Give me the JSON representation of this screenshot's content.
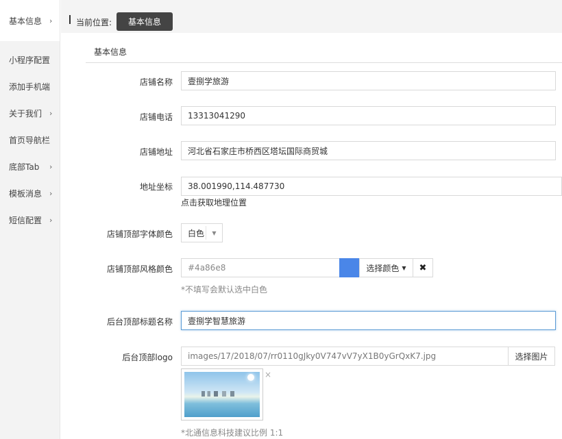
{
  "sidebar": {
    "items": [
      {
        "label": "基本信息",
        "chevron": "›"
      },
      {
        "label": "小程序配置",
        "chevron": ""
      },
      {
        "label": "添加手机端",
        "chevron": ""
      },
      {
        "label": "关于我们",
        "chevron": "›"
      },
      {
        "label": "首页导航栏",
        "chevron": ""
      },
      {
        "label": "底部Tab",
        "chevron": "›"
      },
      {
        "label": "模板消息",
        "chevron": "›"
      },
      {
        "label": "短信配置",
        "chevron": "›"
      }
    ]
  },
  "breadcrumb": {
    "label": "当前位置:",
    "current": "基本信息"
  },
  "panel": {
    "title": "基本信息"
  },
  "form": {
    "shop_name": {
      "label": "店铺名称",
      "value": "壹捌学旅游"
    },
    "shop_phone": {
      "label": "店铺电话",
      "value": "13313041290"
    },
    "shop_address": {
      "label": "店铺地址",
      "value": "河北省石家庄市桥西区塔坛国际商贸城"
    },
    "coords": {
      "label": "地址坐标",
      "value": "38.001990,114.487730",
      "link": "点击获取地理位置"
    },
    "font_color": {
      "label": "店铺顶部字体颜色",
      "value": "白色"
    },
    "style_color": {
      "label": "店铺顶部风格颜色",
      "value": "#4a86e8",
      "pick_label": "选择颜色",
      "clear_label": "✖",
      "hint": "*不填写会默认选中白色",
      "swatch_color": "#4a86e8"
    },
    "admin_title": {
      "label": "后台顶部标题名称",
      "value": "壹捌学智慧旅游"
    },
    "admin_logo": {
      "label": "后台顶部logo",
      "value": "images/17/2018/07/rr0110gJky0V747vV7yX1B0yGrQxK7.jpg",
      "pick_label": "选择图片",
      "remove_label": "×",
      "hint": "*北通信息科技建议比例 1:1"
    }
  }
}
